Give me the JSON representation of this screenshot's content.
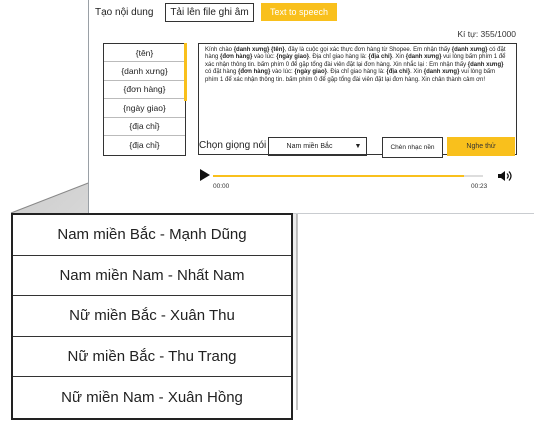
{
  "toolbar": {
    "content_label": "Tạo nội dung",
    "upload_button": "Tải lên file ghi âm",
    "tts_button": "Text to speech"
  },
  "char_count": "Kí tự: 355/1000",
  "variables": [
    "{tên}",
    "{danh xưng}",
    "{đơn hàng}",
    "{ngày giao}",
    "{địa chỉ}",
    "{địa chỉ}"
  ],
  "message": {
    "segments": [
      {
        "t": "Kính chào ",
        "b": false
      },
      {
        "t": "{danh xưng}",
        "b": true
      },
      {
        "t": " ",
        "b": false
      },
      {
        "t": "{tên}",
        "b": true
      },
      {
        "t": ", đây là cuộc gọi xác thực đơn hàng từ Shopee. Em nhận thấy ",
        "b": false
      },
      {
        "t": "{danh xưng}",
        "b": true
      },
      {
        "t": " có đặt hàng ",
        "b": false
      },
      {
        "t": "{đơn hàng}",
        "b": true
      },
      {
        "t": " vào lúc: ",
        "b": false
      },
      {
        "t": "{ngày giao}",
        "b": true
      },
      {
        "t": ". Địa chỉ giao hàng là: ",
        "b": false
      },
      {
        "t": "{địa chỉ}",
        "b": true
      },
      {
        "t": ". Xin ",
        "b": false
      },
      {
        "t": "{danh xưng}",
        "b": true
      },
      {
        "t": " vui lòng bấm phím 1 để xác nhận thông tin. bấm phím 0 để gặp tổng đài viên đặt lại đơn hàng. Xin nhắc lại : Em nhận thấy ",
        "b": false
      },
      {
        "t": "{danh xưng}",
        "b": true
      },
      {
        "t": " có đặt hàng ",
        "b": false
      },
      {
        "t": "{đơn hàng}",
        "b": true
      },
      {
        "t": " vào lúc: ",
        "b": false
      },
      {
        "t": "{ngày giao}",
        "b": true
      },
      {
        "t": ". Địa chỉ giao hàng là: ",
        "b": false
      },
      {
        "t": "{địa chỉ}",
        "b": true
      },
      {
        "t": ". Xin ",
        "b": false
      },
      {
        "t": "{danh xưng}",
        "b": true
      },
      {
        "t": " vui lòng bấm phím 1 để xác nhận thông tin. bấm phím 0 để gặp tổng đài viên đặt lại đơn hàng. Xin chân thành cảm ơn!",
        "b": false
      }
    ]
  },
  "voice": {
    "label": "Chọn giọng nói",
    "selected": "Nam miền Bắc",
    "caret": "▼",
    "options": [
      "Nam miền Bắc - Mạnh Dũng",
      "Nam miền Nam - Nhất Nam",
      "Nữ miền Bắc - Xuân Thu",
      "Nữ miền Bắc - Thu Trang",
      "Nữ miền Nam - Xuân Hồng"
    ]
  },
  "music_button": "Chèn nhạc nền",
  "listen_button": "Nghe thử",
  "player": {
    "current": "00:00",
    "duration": "00:23",
    "progress": 0.93,
    "play_icon": "play-icon",
    "volume_icon": "volume-icon"
  },
  "colors": {
    "accent": "#f9c01c"
  }
}
